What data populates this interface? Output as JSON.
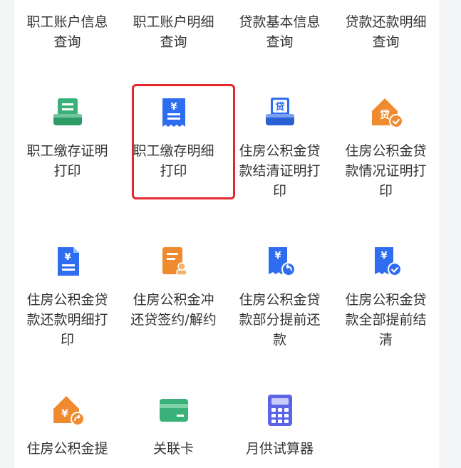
{
  "colors": {
    "green": "#3bb17a",
    "blue": "#2f6df0",
    "orange": "#f08a2e",
    "purple": "#5b63e6",
    "highlight": "#e3262c"
  },
  "services": [
    {
      "id": "emp-account-info",
      "label": "职工账户信息查询",
      "icon": "none"
    },
    {
      "id": "emp-account-detail",
      "label": "职工账户明细查询",
      "icon": "none"
    },
    {
      "id": "loan-basic-info",
      "label": "贷款基本信息查询",
      "icon": "none"
    },
    {
      "id": "loan-repay-detail",
      "label": "贷款还款明细查询",
      "icon": "none"
    },
    {
      "id": "emp-deposit-cert",
      "label": "职工缴存证明打印",
      "icon": "printer-doc-icon",
      "color": "#3bb17a"
    },
    {
      "id": "emp-deposit-detail",
      "label": "职工缴存明细打印",
      "icon": "receipt-yuan-icon",
      "color": "#2f6df0",
      "selected": true
    },
    {
      "id": "loan-settle-cert",
      "label": "住房公积金贷款结清证明打印",
      "icon": "loan-printer-icon",
      "color": "#2f6df0"
    },
    {
      "id": "loan-status-cert",
      "label": "住房公积金贷款情况证明打印",
      "icon": "house-loan-check-icon",
      "color": "#f08a2e"
    },
    {
      "id": "loan-repay-detail-print",
      "label": "住房公积金贷款还款明细打印",
      "icon": "yuan-document-icon",
      "color": "#2f6df0"
    },
    {
      "id": "offset-repay-sign",
      "label": "住房公积金冲还贷签约/解约",
      "icon": "contract-stamp-icon",
      "color": "#f08a2e"
    },
    {
      "id": "partial-prepay",
      "label": "住房公积金贷款部分提前还款",
      "icon": "receipt-return-icon",
      "color": "#2f6df0"
    },
    {
      "id": "full-prepay",
      "label": "住房公积金贷款全部提前结清",
      "icon": "receipt-check-icon",
      "color": "#2f6df0"
    },
    {
      "id": "fund-withdraw",
      "label": "住房公积金提",
      "icon": "house-yuan-arrow-icon",
      "color": "#f08a2e"
    },
    {
      "id": "linked-card",
      "label": "关联卡",
      "icon": "bank-card-icon",
      "color": "#3bb17a"
    },
    {
      "id": "monthly-calc",
      "label": "月供试算器",
      "icon": "calculator-icon",
      "color": "#5b63e6"
    }
  ]
}
